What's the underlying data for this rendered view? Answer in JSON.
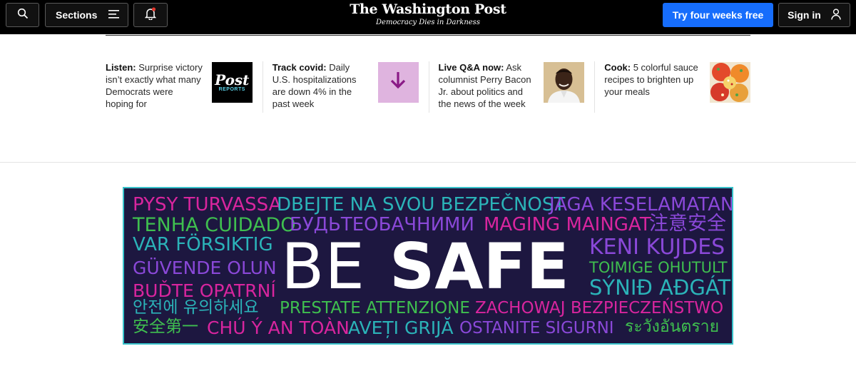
{
  "header": {
    "sections_label": "Sections",
    "logo_name": "The Washington Post",
    "logo_tagline": "Democracy Dies in Darkness",
    "subscribe_label": "Try four weeks free",
    "signin_label": "Sign in",
    "icons": [
      "search-icon",
      "menu-icon",
      "bell-icon",
      "user-icon"
    ],
    "subscribe_color": "#166dfc"
  },
  "teasers": [
    {
      "kicker": "Listen:",
      "text": "Surprise victory isn’t exactly what many Democrats were hoping for",
      "thumb_title": "Post",
      "thumb_sub": "REPORTS"
    },
    {
      "kicker": "Track covid:",
      "text": "Daily U.S. hospitalizations are down 4% in the past week"
    },
    {
      "kicker": "Live Q&A now:",
      "text": "Ask columnist Perry Bacon Jr. about politics and the news of the week"
    },
    {
      "kicker": "Cook:",
      "text": "5 colorful sauce recipes to brighten up your meals"
    }
  ],
  "banner": {
    "headline_be": "BE",
    "headline_safe": "SAFE",
    "words": [
      "PYSY TURVASSA",
      "DBEJTE NA SVOU BEZPEČNOST",
      "JAGA KESELAMATAN",
      "TENHA CUIDADO",
      "БУДЬТЕОБАЧНИМИ",
      "MAGING MAINGAT",
      "注意安全",
      "VAR FÖRSIKTIG",
      "KENI KUJDES",
      "GÜVENDE OLUN",
      "TOIMIGE OHUTULT",
      "BUĎTE OPATRNÍ",
      "SÝNIÐ AÐGÁT",
      "안전에 유의하세요",
      "PRESTATE ATTENZIONE",
      "ZACHOWAJ BEZPIECZEŃSTWO",
      "安全第一",
      "CHÚ Ý AN TOÀN",
      "AVEȚI GRIJĂ",
      "OSTANITE SIGURNI",
      "ระวังอันตราย"
    ],
    "colors": {
      "background": "#1d1740",
      "border": "#37c1c9",
      "teal": "#2bb3b8",
      "green": "#3fbf4f",
      "purple": "#8a48d8",
      "magenta": "#d8259e"
    }
  }
}
